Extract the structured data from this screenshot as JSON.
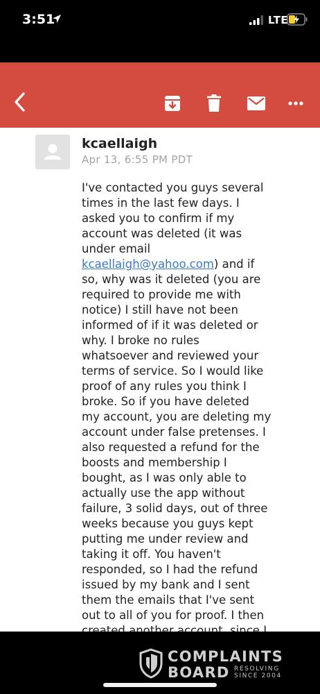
{
  "status_bar": {
    "time": "3:51",
    "network": "LTE"
  },
  "toolbar": {
    "icons": [
      "back-icon",
      "archive-icon",
      "trash-icon",
      "mail-icon",
      "more-icon"
    ],
    "color": "#d44c3f"
  },
  "message": {
    "sender": "kcaellaigh",
    "date": "Apr 13, 6:55 PM PDT",
    "link_color": "#3b79c4",
    "body_lines": [
      "I've contacted you guys several",
      "times in the last few days. I",
      "asked you to confirm if my",
      "account was deleted (it was",
      "under email",
      null,
      "so, why was it deleted (you are",
      "required to provide me with",
      "notice) I still have not been",
      "informed of if it was deleted or",
      "why. I broke no rules",
      "whatsoever and reviewed your",
      "terms of service. So I would like",
      "proof of any rules you think I",
      "broke. So if you have deleted",
      "my account, you are deleting my",
      "account under false pretenses. I",
      "also requested a refund for the",
      "boosts and membership I",
      "bought, as I was only able to",
      "actually use the app without",
      "failure, 3 solid days, out of three",
      "weeks because you guys kept",
      "putting me under review and",
      "taking it off. You haven't",
      "responded, so I had the refund",
      "issued by my bank and I sent",
      "them the emails that I've sent",
      "out to all of you for proof. I then",
      "created another account, since I"
    ],
    "email_link": "kcaellaigh@yahoo.com",
    "email_line_suffix": ") and if"
  },
  "watermark": {
    "line1": "COMPLAINTS",
    "line2": "BOARD",
    "tag1": "RESOLVING",
    "tag2": "SINCE 2004"
  }
}
